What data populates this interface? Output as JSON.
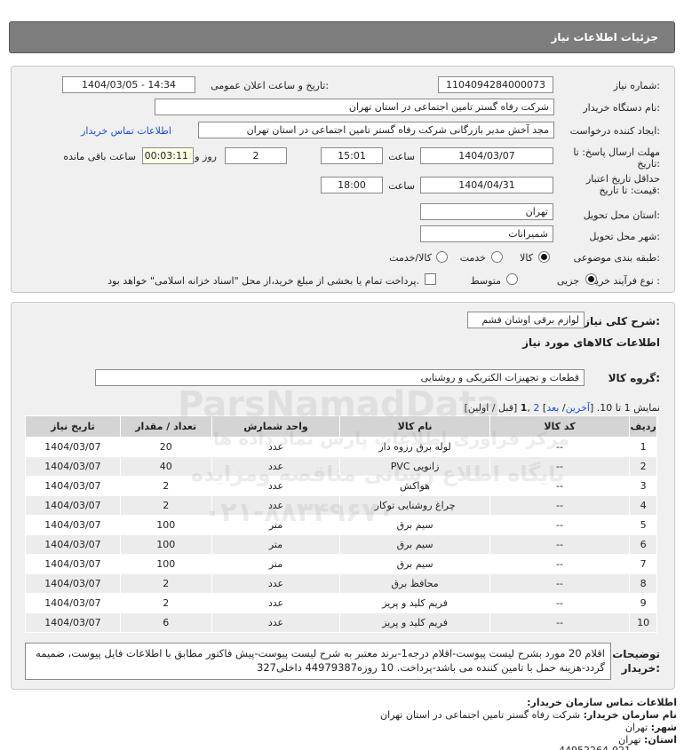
{
  "header": {
    "title": "جزئیات اطلاعات نیاز"
  },
  "form": {
    "need_number_label": "شماره نیاز:",
    "need_number": "1104094284000073",
    "announce_label": "تاریخ و ساعت اعلان عمومی:",
    "announce_value": "1404/03/05 - 14:34",
    "buyer_org_label": "نام دستگاه خریدار:",
    "buyer_org": "شرکت رفاه گستر تامین اجتماعی در استان تهران",
    "requester_label": "ایجاد کننده درخواست:",
    "requester": "مجد آخش مدیر بازرگانی شرکت رفاه گستر تامین اجتماعی در استان تهران",
    "contact_link": "اطلاعات تماس خریدار",
    "deadline_label_1": "مهلت ارسال پاسخ: تا",
    "deadline_label_2": "تاریخ:",
    "deadline_date": "1404/03/07",
    "time_label": "ساعت",
    "deadline_time": "15:01",
    "days_value": "2",
    "days_label": "روز و",
    "remaining_time": "00:03:11",
    "remaining_label": "ساعت باقی مانده",
    "validity_label_1": "حداقل تاریخ اعتبار",
    "validity_label_2": "قیمت: تا تاریخ:",
    "validity_date": "1404/04/31",
    "validity_time": "18:00",
    "province_label": "استان محل تحویل:",
    "province": "تهران",
    "city_label": "شهر محل تحویل:",
    "city": "شمیرانات",
    "category_label": "طبقه بندی موضوعی:",
    "category_options": [
      "کالا",
      "خدمت",
      "کالا/خدمت"
    ],
    "process_label": "نوع فرآیند خرید :",
    "process_options": [
      "جزیی",
      "متوسط"
    ],
    "payment_note": "پرداخت تمام یا بخشی از مبلغ خرید،از محل \"اسناد خزانه اسلامی\" خواهد بود."
  },
  "general": {
    "summary_label": "شرح کلی نیاز:",
    "summary_value": "لوازم برقی اوشان فشم",
    "goods_info_title": "اطلاعات کالاهای مورد نیاز",
    "group_label": "گروه کالا:",
    "group_value": "قطعات و تجهیزات الکتریکی و روشنایی",
    "pagination": {
      "show_text": "نمایش 1 تا 10.",
      "last": "آخرین",
      "next": "بعد",
      "page2": "2",
      "page1": "1",
      "rest": "[قبل / اولین]"
    }
  },
  "table": {
    "headers": [
      "ردیف",
      "کد کالا",
      "نام کالا",
      "واحد شمارش",
      "تعداد / مقدار",
      "تاریخ نیاز"
    ],
    "rows": [
      [
        "1",
        "--",
        "لوله برق رزوه دار",
        "عدد",
        "20",
        "1404/03/07"
      ],
      [
        "2",
        "--",
        "زانویی PVC",
        "عدد",
        "40",
        "1404/03/07"
      ],
      [
        "3",
        "--",
        "هواکش",
        "عدد",
        "2",
        "1404/03/07"
      ],
      [
        "4",
        "--",
        "چراغ روشنایی توکار",
        "عدد",
        "2",
        "1404/03/07"
      ],
      [
        "5",
        "--",
        "سیم برق",
        "متر",
        "100",
        "1404/03/07"
      ],
      [
        "6",
        "--",
        "سیم برق",
        "متر",
        "100",
        "1404/03/07"
      ],
      [
        "7",
        "--",
        "سیم برق",
        "متر",
        "100",
        "1404/03/07"
      ],
      [
        "8",
        "--",
        "محافظ برق",
        "عدد",
        "2",
        "1404/03/07"
      ],
      [
        "9",
        "--",
        "فریم کلید و پریز",
        "عدد",
        "2",
        "1404/03/07"
      ],
      [
        "10",
        "--",
        "فریم کلید و پریز",
        "عدد",
        "6",
        "1404/03/07"
      ]
    ]
  },
  "buyer_notes": {
    "label_1": "توضیحات",
    "label_2": "خریدار:",
    "text": "اقلام 20 مورد بشرح لیست پیوست-اقلام درجه1-برند معتبر به شرح لیست پیوست-پیش فاکتور مطابق با اطلاعات فایل پیوست، ضمیمه گردد-هزینه حمل با تامین کننده می باشد-پرداخت. 10 روزه44979387 داخلی327"
  },
  "contact": {
    "title": "اطلاعات تماس سازمان خریدار:",
    "org_label": "نام سازمان خریدار:",
    "org_value": "شرکت رفاه گستر تامین اجتماعی در استان تهران",
    "city_label": "شهر:",
    "city_value": "تهران",
    "province_label": "استان:",
    "province_value": "تهران",
    "phone_partial": "44952264-021"
  },
  "watermark": {
    "line1": "ParsNamadData",
    "line2": "مرکز فراوری اطلاعات پارس نماد داده ها",
    "line3": "پایگاه اطلاع رسانی مناقصه ومزایده",
    "line4": "۰۲۱-۸۸۳۴۹۶۷۰"
  }
}
